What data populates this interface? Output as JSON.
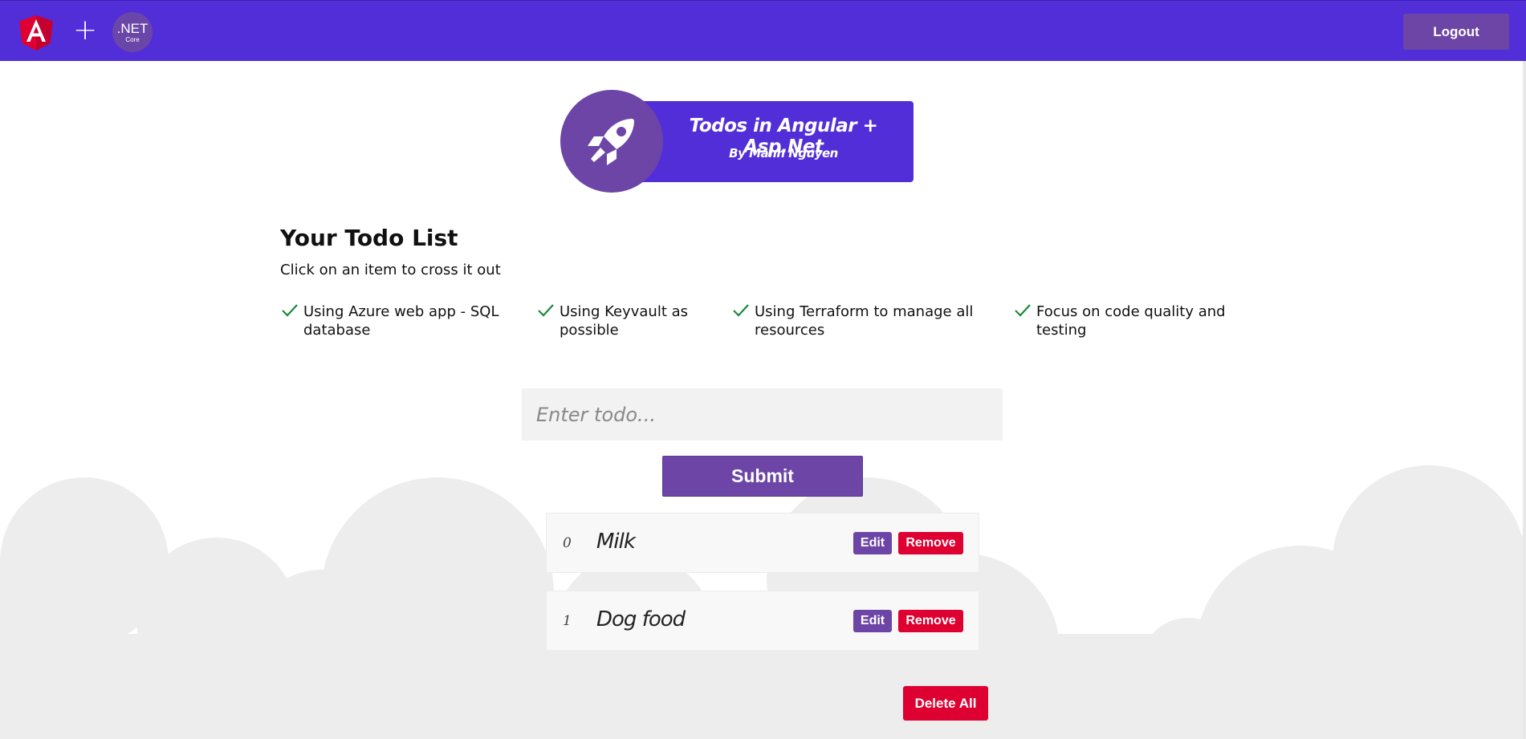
{
  "colors": {
    "navbar": "#522ed8",
    "purple_button": "#6c45a6",
    "danger": "#dd0031",
    "angular_red": "#dd0031",
    "cloud": "#ededed",
    "check": "#1a8a3a"
  },
  "navbar": {
    "angular_icon": "angular-logo-icon",
    "plus_symbol": "+",
    "dotnet_main": ".NET",
    "dotnet_sub": "Core",
    "logout_label": "Logout"
  },
  "banner": {
    "icon": "rocket-icon",
    "title": "Todos in Angular + Asp.Net",
    "subtitle": "By Manh Nguyen"
  },
  "main": {
    "heading": "Your Todo List",
    "subtitle": "Click on an item to cross it out",
    "features": [
      "Using Azure web app - SQL database",
      "Using Keyvault as possible",
      "Using Terraform to manage all resources",
      "Focus on code quality and testing"
    ],
    "input": {
      "placeholder": "Enter todo...",
      "value": ""
    },
    "submit_label": "Submit",
    "todos": [
      {
        "index": "0",
        "text": "Milk",
        "edit_label": "Edit",
        "remove_label": "Remove"
      },
      {
        "index": "1",
        "text": "Dog food",
        "edit_label": "Edit",
        "remove_label": "Remove"
      }
    ],
    "delete_all_label": "Delete All"
  }
}
